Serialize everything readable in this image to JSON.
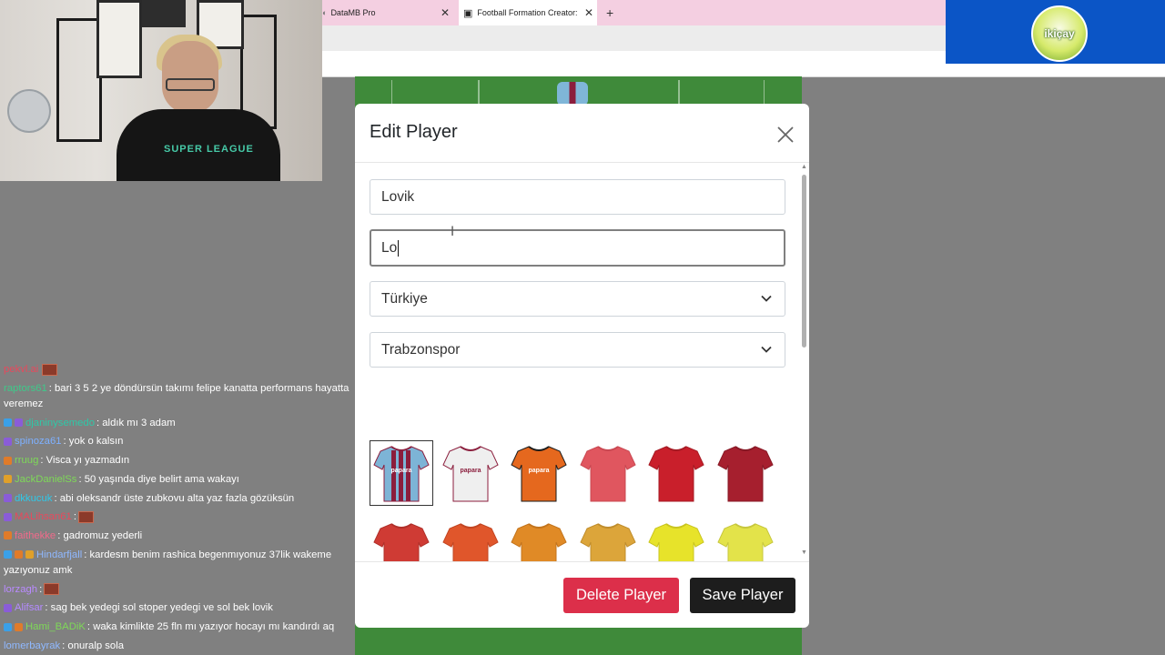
{
  "browser": {
    "tabs": [
      {
        "label": "DataMB Pro",
        "active": false
      },
      {
        "label": "Football Formation Creator: Re",
        "active": true
      }
    ],
    "close_glyph": "✕",
    "new_tab_glyph": "+"
  },
  "sponsor": {
    "logo_text": "ikiçay"
  },
  "webcam": {
    "shirt_text": "SUPER LEAGUE"
  },
  "modal": {
    "title": "Edit Player",
    "first_name_value": "Lovik",
    "last_name_value": "Lo",
    "country_value": "Türkiye",
    "club_value": "Trabzonspor",
    "delete_label": "Delete Player",
    "save_label": "Save Player",
    "kits": [
      {
        "name": "trabzonspor-home",
        "body": "#7db4d6",
        "accent": "#8b1e3d",
        "stripes": true,
        "sponsor": "papara",
        "selected": true
      },
      {
        "name": "trabzonspor-away",
        "body": "#efefef",
        "accent": "#8b1e3d",
        "stripes": false,
        "sponsor": "papara"
      },
      {
        "name": "trabzonspor-third",
        "body": "#e5681e",
        "accent": "#1b1b1b",
        "stripes": false,
        "sponsor": "papara"
      },
      {
        "name": "kit-coral",
        "body": "#e0565f",
        "accent": "#c94852"
      },
      {
        "name": "kit-red",
        "body": "#c91f2b",
        "accent": "#a51a23"
      },
      {
        "name": "kit-crimson",
        "body": "#a61f2e",
        "accent": "#871825"
      },
      {
        "name": "kit-red-2",
        "body": "#cf3b34",
        "accent": "#b0302a"
      },
      {
        "name": "kit-orange-red",
        "body": "#e0562b",
        "accent": "#c24522"
      },
      {
        "name": "kit-orange",
        "body": "#e08a26",
        "accent": "#c3741c"
      },
      {
        "name": "kit-amber",
        "body": "#dca53a",
        "accent": "#c08d2c"
      },
      {
        "name": "kit-yellow",
        "body": "#e7e32a",
        "accent": "#c9c51f"
      },
      {
        "name": "kit-yellow-2",
        "body": "#e3e34a",
        "accent": "#c7c73d"
      },
      {
        "name": "kit-lime",
        "body": "#c8dc2e",
        "accent": "#abbf22"
      },
      {
        "name": "kit-light-green",
        "body": "#8fd14a",
        "accent": "#77b53a"
      },
      {
        "name": "kit-green",
        "body": "#5cc44e",
        "accent": "#4aa83f"
      },
      {
        "name": "kit-green-2",
        "body": "#36b04a",
        "accent": "#2a933b"
      },
      {
        "name": "kit-dark-green",
        "body": "#2f8f3c",
        "accent": "#237530"
      },
      {
        "name": "kit-forest",
        "body": "#2e6e34",
        "accent": "#235628"
      }
    ]
  },
  "chat": [
    {
      "user": "pekvl.ai",
      "color": "#e8485c",
      "message": "",
      "badges": [],
      "emote": true
    },
    {
      "user": "raptors61",
      "color": "#3ec98a",
      "message": ": bari 3 5 2 ye döndürsün takımı felipe kanatta performans hayatta veremez",
      "badges": [],
      "wrap": true
    },
    {
      "user": "djaninysemedo",
      "color": "#2ec8a8",
      "message": ": aldık mı 3 adam",
      "badges": [
        "#3aa0e8",
        "#8a5cd8"
      ]
    },
    {
      "user": "spinoza61",
      "color": "#7db0ff",
      "message": ": yok o kalsın",
      "badges": [
        "#8a5cd8"
      ]
    },
    {
      "user": "rruug",
      "color": "#7ed957",
      "message": ": Visca yı yazmadın",
      "badges": [
        "#e07b2a"
      ]
    },
    {
      "user": "JackDanielSs",
      "color": "#7ed957",
      "message": ": 50 yaşında diye belirt ama wakayı",
      "badges": [
        "#e0a02a"
      ]
    },
    {
      "user": "dkkucuk",
      "color": "#2ec8e8",
      "message": ": abi oleksandr üste zubkovu alta yaz fazla gözüksün",
      "badges": [
        "#8a5cd8"
      ]
    },
    {
      "user": "MALihsan61",
      "color": "#e8485c",
      "message": ":",
      "badges": [
        "#8a5cd8"
      ],
      "emote": true
    },
    {
      "user": "faithekke",
      "color": "#f06a8a",
      "message": ": gadromuz yederli",
      "badges": [
        "#e07b2a"
      ]
    },
    {
      "user": "Hindarfjall",
      "color": "#8fb8ff",
      "message": ": kardesm benim rashica begenmıyonuz 37lik wakeme yazıyonuz amk",
      "badges": [
        "#3aa0e8",
        "#e07b2a",
        "#e0a02a"
      ],
      "wrap": true
    },
    {
      "user": "lorzagh",
      "color": "#b98aff",
      "message": ":",
      "badges": [],
      "emote": true
    },
    {
      "user": "Alifsar",
      "color": "#b48aff",
      "message": ": sag bek yedegi sol stoper yedegi ve sol bek lovik",
      "badges": [
        "#8a5cd8"
      ]
    },
    {
      "user": "Hami_BADiK",
      "color": "#7ed957",
      "message": ": waka kimlikte 25 fln mı yazıyor hocayı mı kandırdı aq",
      "badges": [
        "#3aa0e8",
        "#e07b2a"
      ]
    },
    {
      "user": "lomerbayrak",
      "color": "#8fb8ff",
      "message": ": onuralp sola",
      "badges": []
    }
  ]
}
